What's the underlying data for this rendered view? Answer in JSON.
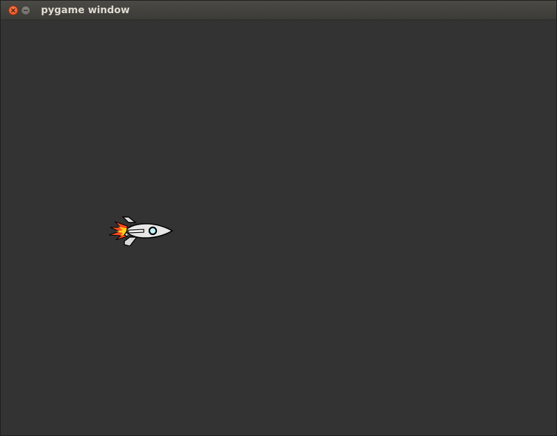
{
  "window": {
    "title": "pygame window"
  },
  "titlebar": {
    "buttons": [
      {
        "name": "close",
        "icon": "close-icon",
        "color": "#e5541e"
      },
      {
        "name": "minimize",
        "icon": "minimize-icon",
        "color": "#73726d"
      }
    ]
  },
  "game": {
    "background_color": "#333333",
    "sprite": {
      "name": "rocket",
      "icon": "rocket-ship-icon",
      "colors": {
        "body": "#e6e6e6",
        "outline": "#000000",
        "window": "#bff6ff",
        "flame_outer": "#ff4a1c",
        "flame_inner": "#ffd21a"
      }
    }
  }
}
